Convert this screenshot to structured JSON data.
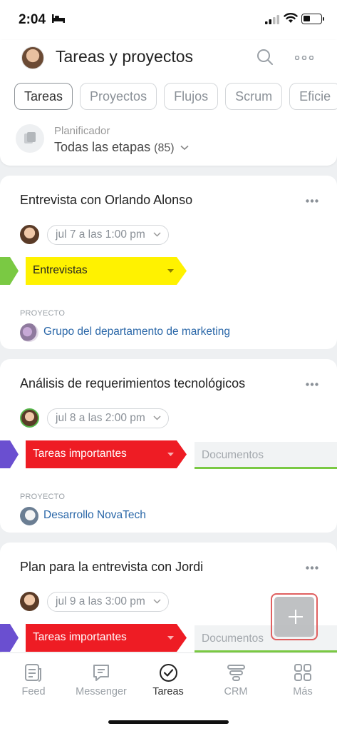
{
  "status_bar": {
    "time": "2:04"
  },
  "header": {
    "title": "Tareas y proyectos",
    "tabs": [
      "Tareas",
      "Proyectos",
      "Flujos",
      "Scrum",
      "Eficie"
    ],
    "planner": {
      "label": "Planificador",
      "value": "Todas las etapas",
      "count": "(85)"
    }
  },
  "project_label": "PROYECTO",
  "tasks": [
    {
      "title": "Entrevista con Orlando Alonso",
      "date": "jul 7 a las 1:00 pm",
      "stage": "Entrevistas",
      "stage_color": "#fff200",
      "stage_left_color": "#7ac943",
      "project": "Grupo del departamento de marketing"
    },
    {
      "title": "Análisis de requerimientos tecnológicos",
      "date": "jul 8 a las 2:00 pm",
      "stage": "Tareas importantes",
      "stage_color": "#ee1c24",
      "stage_left_color": "#6a4fd0",
      "next_stage": "Documentos",
      "project": "Desarrollo NovaTech"
    },
    {
      "title": "Plan para la entrevista con Jordi",
      "date": "jul 9 a las 3:00 pm",
      "stage": "Tareas importantes",
      "stage_color": "#ee1c24",
      "stage_left_color": "#6a4fd0",
      "next_stage": "Documentos"
    }
  ],
  "bottom_nav": [
    {
      "label": "Feed",
      "icon": "feed-icon"
    },
    {
      "label": "Messenger",
      "icon": "messenger-icon"
    },
    {
      "label": "Tareas",
      "icon": "tasks-icon"
    },
    {
      "label": "CRM",
      "icon": "crm-icon"
    },
    {
      "label": "Más",
      "icon": "grid-icon"
    }
  ]
}
